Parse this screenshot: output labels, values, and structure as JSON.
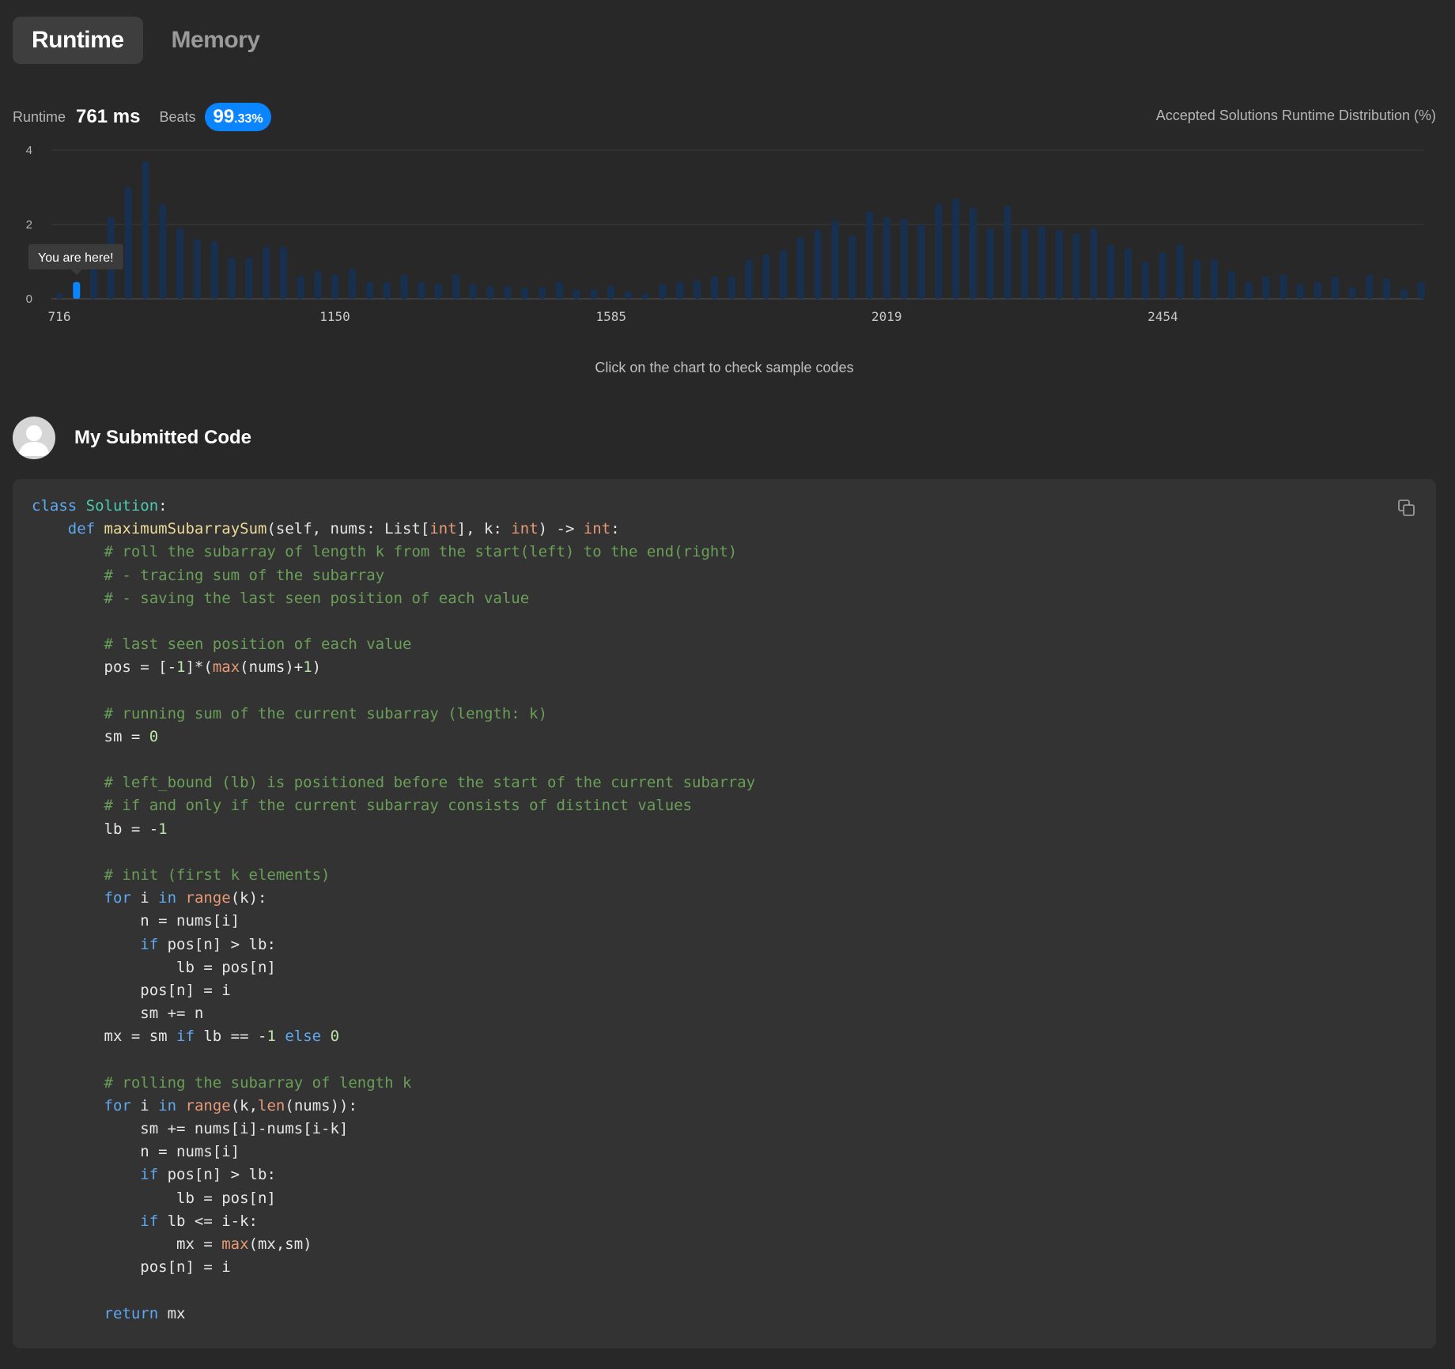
{
  "tabs": [
    {
      "label": "Runtime",
      "active": true
    },
    {
      "label": "Memory",
      "active": false
    }
  ],
  "stats": {
    "runtime_label": "Runtime",
    "runtime_value": "761 ms",
    "beats_label": "Beats",
    "beats_whole": "99",
    "beats_fraction": ".33%"
  },
  "distribution_title": "Accepted Solutions Runtime Distribution (%)",
  "chart_data": {
    "type": "bar",
    "ylim": [
      0,
      4
    ],
    "y_ticks": [
      "0",
      "2",
      "4"
    ],
    "x_ticks": [
      {
        "label": "716",
        "value": 716
      },
      {
        "label": "1150",
        "value": 1150
      },
      {
        "label": "1585",
        "value": 1585
      },
      {
        "label": "2019",
        "value": 2019
      },
      {
        "label": "2454",
        "value": 2454
      }
    ],
    "bin_start": 716,
    "bin_width": 27.15,
    "values": [
      0.15,
      0.45,
      1.05,
      2.2,
      3.0,
      3.7,
      2.55,
      1.9,
      1.6,
      1.55,
      1.1,
      1.1,
      1.4,
      1.4,
      0.6,
      0.75,
      0.65,
      0.8,
      0.45,
      0.45,
      0.65,
      0.45,
      0.4,
      0.65,
      0.4,
      0.35,
      0.35,
      0.3,
      0.3,
      0.45,
      0.25,
      0.25,
      0.35,
      0.2,
      0.15,
      0.4,
      0.45,
      0.5,
      0.6,
      0.6,
      1.05,
      1.2,
      1.3,
      1.65,
      1.85,
      2.1,
      1.7,
      2.35,
      2.2,
      2.15,
      2.0,
      2.55,
      2.7,
      2.45,
      1.9,
      2.5,
      1.9,
      1.95,
      1.85,
      1.75,
      1.9,
      1.45,
      1.35,
      1.0,
      1.25,
      1.45,
      1.05,
      1.05,
      0.75,
      0.45,
      0.6,
      0.65,
      0.4,
      0.45,
      0.6,
      0.3,
      0.65,
      0.55,
      0.25,
      0.45
    ],
    "highlight_index": 1,
    "base_color": "#18304f",
    "highlight_color": "#0a84ff",
    "tooltip": "You are here!",
    "grid": true
  },
  "chart_hint": "Click on the chart to check sample codes",
  "submission": {
    "title": "My Submitted Code",
    "avatar_icon": "user-avatar-icon",
    "copy_icon": "copy-icon",
    "code_lines": [
      "class Solution:",
      "    def maximumSubarraySum(self, nums: List[int], k: int) -> int:",
      "        # roll the subarray of length k from the start(left) to the end(right)",
      "        # - tracing sum of the subarray",
      "        # - saving the last seen position of each value",
      "",
      "        # last seen position of each value",
      "        pos = [-1]*(max(nums)+1)",
      "",
      "        # running sum of the current subarray (length: k)",
      "        sm = 0",
      "",
      "        # left_bound (lb) is positioned before the start of the current subarray",
      "        # if and only if the current subarray consists of distinct values",
      "        lb = -1",
      "",
      "        # init (first k elements)",
      "        for i in range(k):",
      "            n = nums[i]",
      "            if pos[n] > lb:",
      "                lb = pos[n]",
      "            pos[n] = i",
      "            sm += n",
      "        mx = sm if lb == -1 else 0",
      "",
      "        # rolling the subarray of length k",
      "        for i in range(k,len(nums)):",
      "            sm += nums[i]-nums[i-k]",
      "            n = nums[i]",
      "            if pos[n] > lb:",
      "                lb = pos[n]",
      "            if lb <= i-k:",
      "                mx = max(mx,sm)",
      "            pos[n] = i",
      "",
      "        return mx"
    ]
  }
}
